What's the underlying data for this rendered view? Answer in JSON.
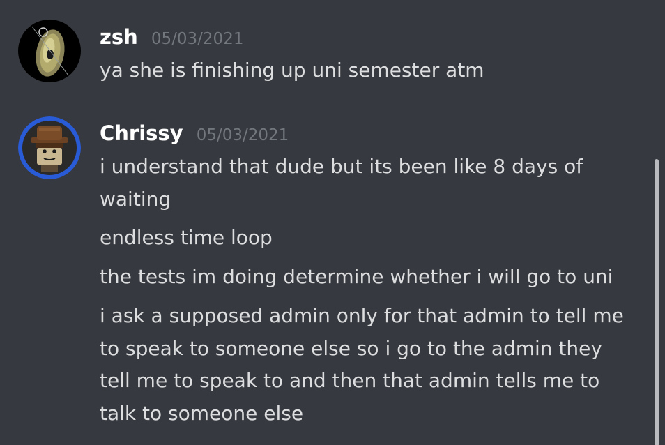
{
  "messages": [
    {
      "username": "zsh",
      "timestamp": "05/03/2021",
      "avatar_icon": "disc-icon",
      "lines": [
        "ya she is finishing up uni semester atm"
      ]
    },
    {
      "username": "Chrissy",
      "timestamp": "05/03/2021",
      "avatar_icon": "lego-minifig-icon",
      "accent_color": "#2a5bd7",
      "lines": [
        "i understand that dude but its been like 8 days of\nwaiting",
        "endless time loop",
        "the tests im doing determine whether i will go to uni",
        "i ask a supposed admin only for that admin to tell me\nto speak to someone else so i go to the admin they\ntell me to speak to and then that admin tells me to\ntalk to someone else"
      ]
    }
  ],
  "colors": {
    "background": "#36393f",
    "username": "#ffffff",
    "timestamp": "#72767d",
    "text": "#dcddde",
    "scrollbar": "#b9bbbe"
  }
}
